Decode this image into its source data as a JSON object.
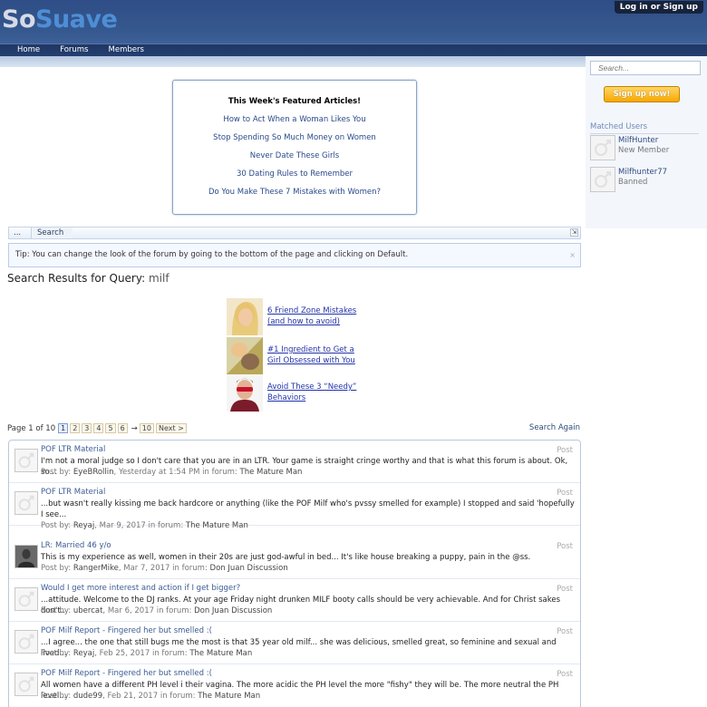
{
  "header": {
    "logo_part1": "So",
    "logo_part2": "Suave",
    "login_label": "Log in or Sign up"
  },
  "nav": {
    "items": [
      "Home",
      "Forums",
      "Members"
    ]
  },
  "sidebar": {
    "search_placeholder": "Search...",
    "signup_label": "Sign up now!",
    "matched_title": "Matched Users",
    "users": [
      {
        "name": "MilfHunter",
        "role": "New Member"
      },
      {
        "name": "Milfhunter77",
        "role": "Banned"
      }
    ]
  },
  "featured": {
    "heading": "This Week's Featured Articles!",
    "links": [
      "How to Act When a Woman Likes You",
      "Stop Spending So Much Money on Women",
      "Never Date These Girls",
      "30 Dating Rules to Remember",
      "Do You Make These 7 Mistakes with Women?"
    ]
  },
  "breadcrumb": {
    "dots": "...",
    "current": "Search",
    "resize_icon": "⇲"
  },
  "tip": {
    "text": "Tip: You can change the look of the forum by going to the bottom of the page and clicking on Default."
  },
  "results_title": {
    "prefix": "Search Results for Query:",
    "query": "milf"
  },
  "ads": [
    {
      "text": "6 Friend Zone Mistakes (and how to avoid)"
    },
    {
      "text": "#1 Ingredient to Get a Girl Obsessed with You"
    },
    {
      "text": "Avoid These 3 “Needy” Behaviors"
    }
  ],
  "pagination": {
    "label": "Page 1 of 10",
    "pages": [
      "1",
      "2",
      "3",
      "4",
      "5",
      "6"
    ],
    "arrow": "→",
    "last": "10",
    "next": "Next >"
  },
  "search_again": "Search Again",
  "results": [
    {
      "title": "POF LTR Material",
      "type": "Post",
      "snippet": "I'm not a moral judge so I don't care that you are in an LTR. Your game is straight cringe worthy and that is what this forum is about. Ok, so...",
      "by_label": "Post by:",
      "user": "EyeBRollin",
      "date": "Yesterday at 1:54 PM",
      "in_label": "in forum:",
      "forum": "The Mature Man"
    },
    {
      "title": "POF LTR Material",
      "type": "Post",
      "snippet": "...but wasn't really kissing me back hardcore or anything (like the POF Milf who's pvssy smelled for example) I stopped and said 'hopefully I see...",
      "by_label": "Post by:",
      "user": "Reyaj",
      "date": "Mar 9, 2017",
      "in_label": "in forum:",
      "forum": "The Mature Man"
    },
    {
      "title": "LR: Married 46 y/o",
      "type": "Post",
      "snippet": "This is my experience as well, women in their 20s are just god-awful in bed... It's like house breaking a puppy, pain in the @ss.",
      "by_label": "Post by:",
      "user": "RangerMike",
      "date": "Mar 7, 2017",
      "in_label": "in forum:",
      "forum": "Don Juan Discussion"
    },
    {
      "title": "Would I get more interest and action if I get bigger?",
      "type": "Post",
      "snippet": "...attitude. Welcome to the DJ ranks. At your age Friday night drunken MILF booty calls should be very achievable. And for Christ sakes don't...",
      "by_label": "Post by:",
      "user": "ubercat",
      "date": "Mar 6, 2017",
      "in_label": "in forum:",
      "forum": "Don Juan Discussion"
    },
    {
      "title": "POF Milf Report - Fingered her but smelled :(",
      "type": "Post",
      "snippet": "...I agree... the one that still bugs me the most is that 35 year old milf... she was delicious, smelled great, so feminine and sexual and lived...",
      "by_label": "Post by:",
      "user": "Reyaj",
      "date": "Feb 25, 2017",
      "in_label": "in forum:",
      "forum": "The Mature Man"
    },
    {
      "title": "POF Milf Report - Fingered her but smelled :(",
      "type": "Post",
      "snippet": "All women have a different PH level i their vagina. The more acidic the PH level the more \"fishy\" they will be. The more neutral the PH level...",
      "by_label": "Post by:",
      "user": "dude99",
      "date": "Feb 21, 2017",
      "in_label": "in forum:",
      "forum": "The Mature Man"
    }
  ]
}
